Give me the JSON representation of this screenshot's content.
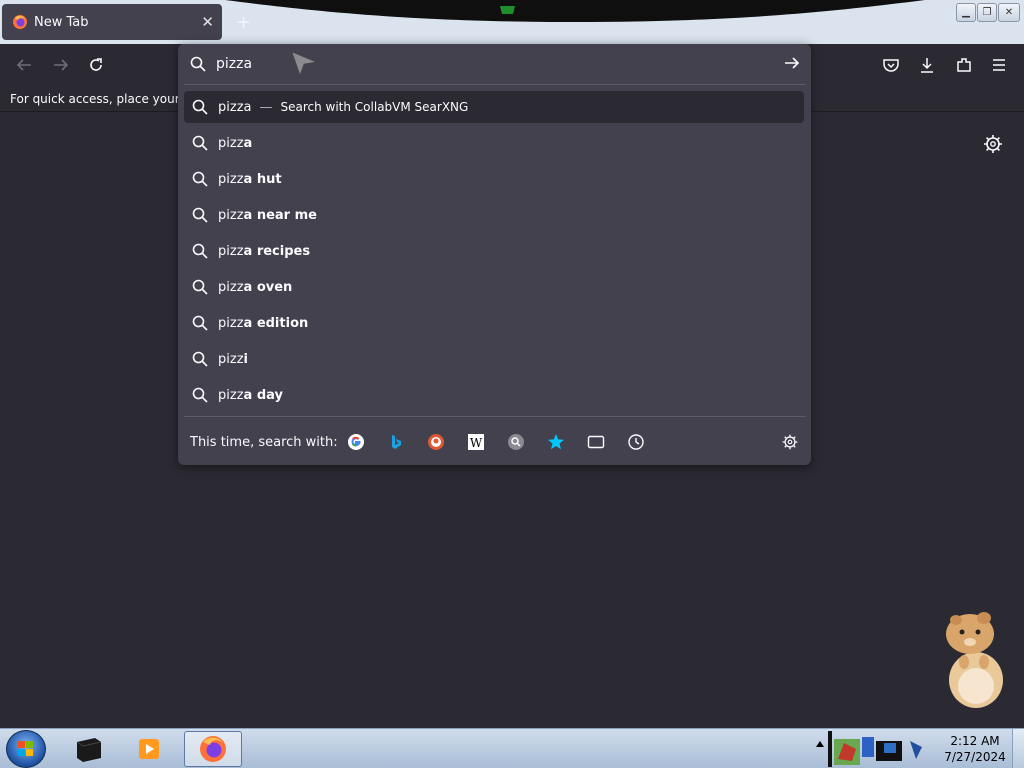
{
  "browser": {
    "tab": {
      "title": "New Tab"
    },
    "bookmarks_bar_text": "For quick access, place your boo"
  },
  "urlbar": {
    "value": "pizza",
    "suggestions": [
      {
        "typed": "pizza",
        "rest": "",
        "note": "Search with CollabVM SearXNG",
        "selected": true
      },
      {
        "typed": "pizz",
        "rest": "a",
        "note": ""
      },
      {
        "typed": "pizz",
        "rest": "a hut",
        "note": ""
      },
      {
        "typed": "pizz",
        "rest": "a near me",
        "note": ""
      },
      {
        "typed": "pizz",
        "rest": "a recipes",
        "note": ""
      },
      {
        "typed": "pizz",
        "rest": "a oven",
        "note": ""
      },
      {
        "typed": "pizz",
        "rest": "a edition",
        "note": ""
      },
      {
        "typed": "pizz",
        "rest": "i",
        "note": ""
      },
      {
        "typed": "pizz",
        "rest": "a day",
        "note": ""
      }
    ],
    "oneoff_label": "This time, search with:",
    "oneoff_engines": [
      "google-icon",
      "bing-icon",
      "duckduckgo-icon",
      "wikipedia-icon",
      "searxng-icon",
      "bookmarks-star-icon",
      "tabs-icon",
      "history-icon"
    ]
  },
  "taskbar": {
    "clock_time": "2:12 AM",
    "clock_date": "7/27/2024"
  },
  "colors": {
    "panel": "#42414d",
    "background": "#2b2a33",
    "text": "#fbfbfe"
  }
}
